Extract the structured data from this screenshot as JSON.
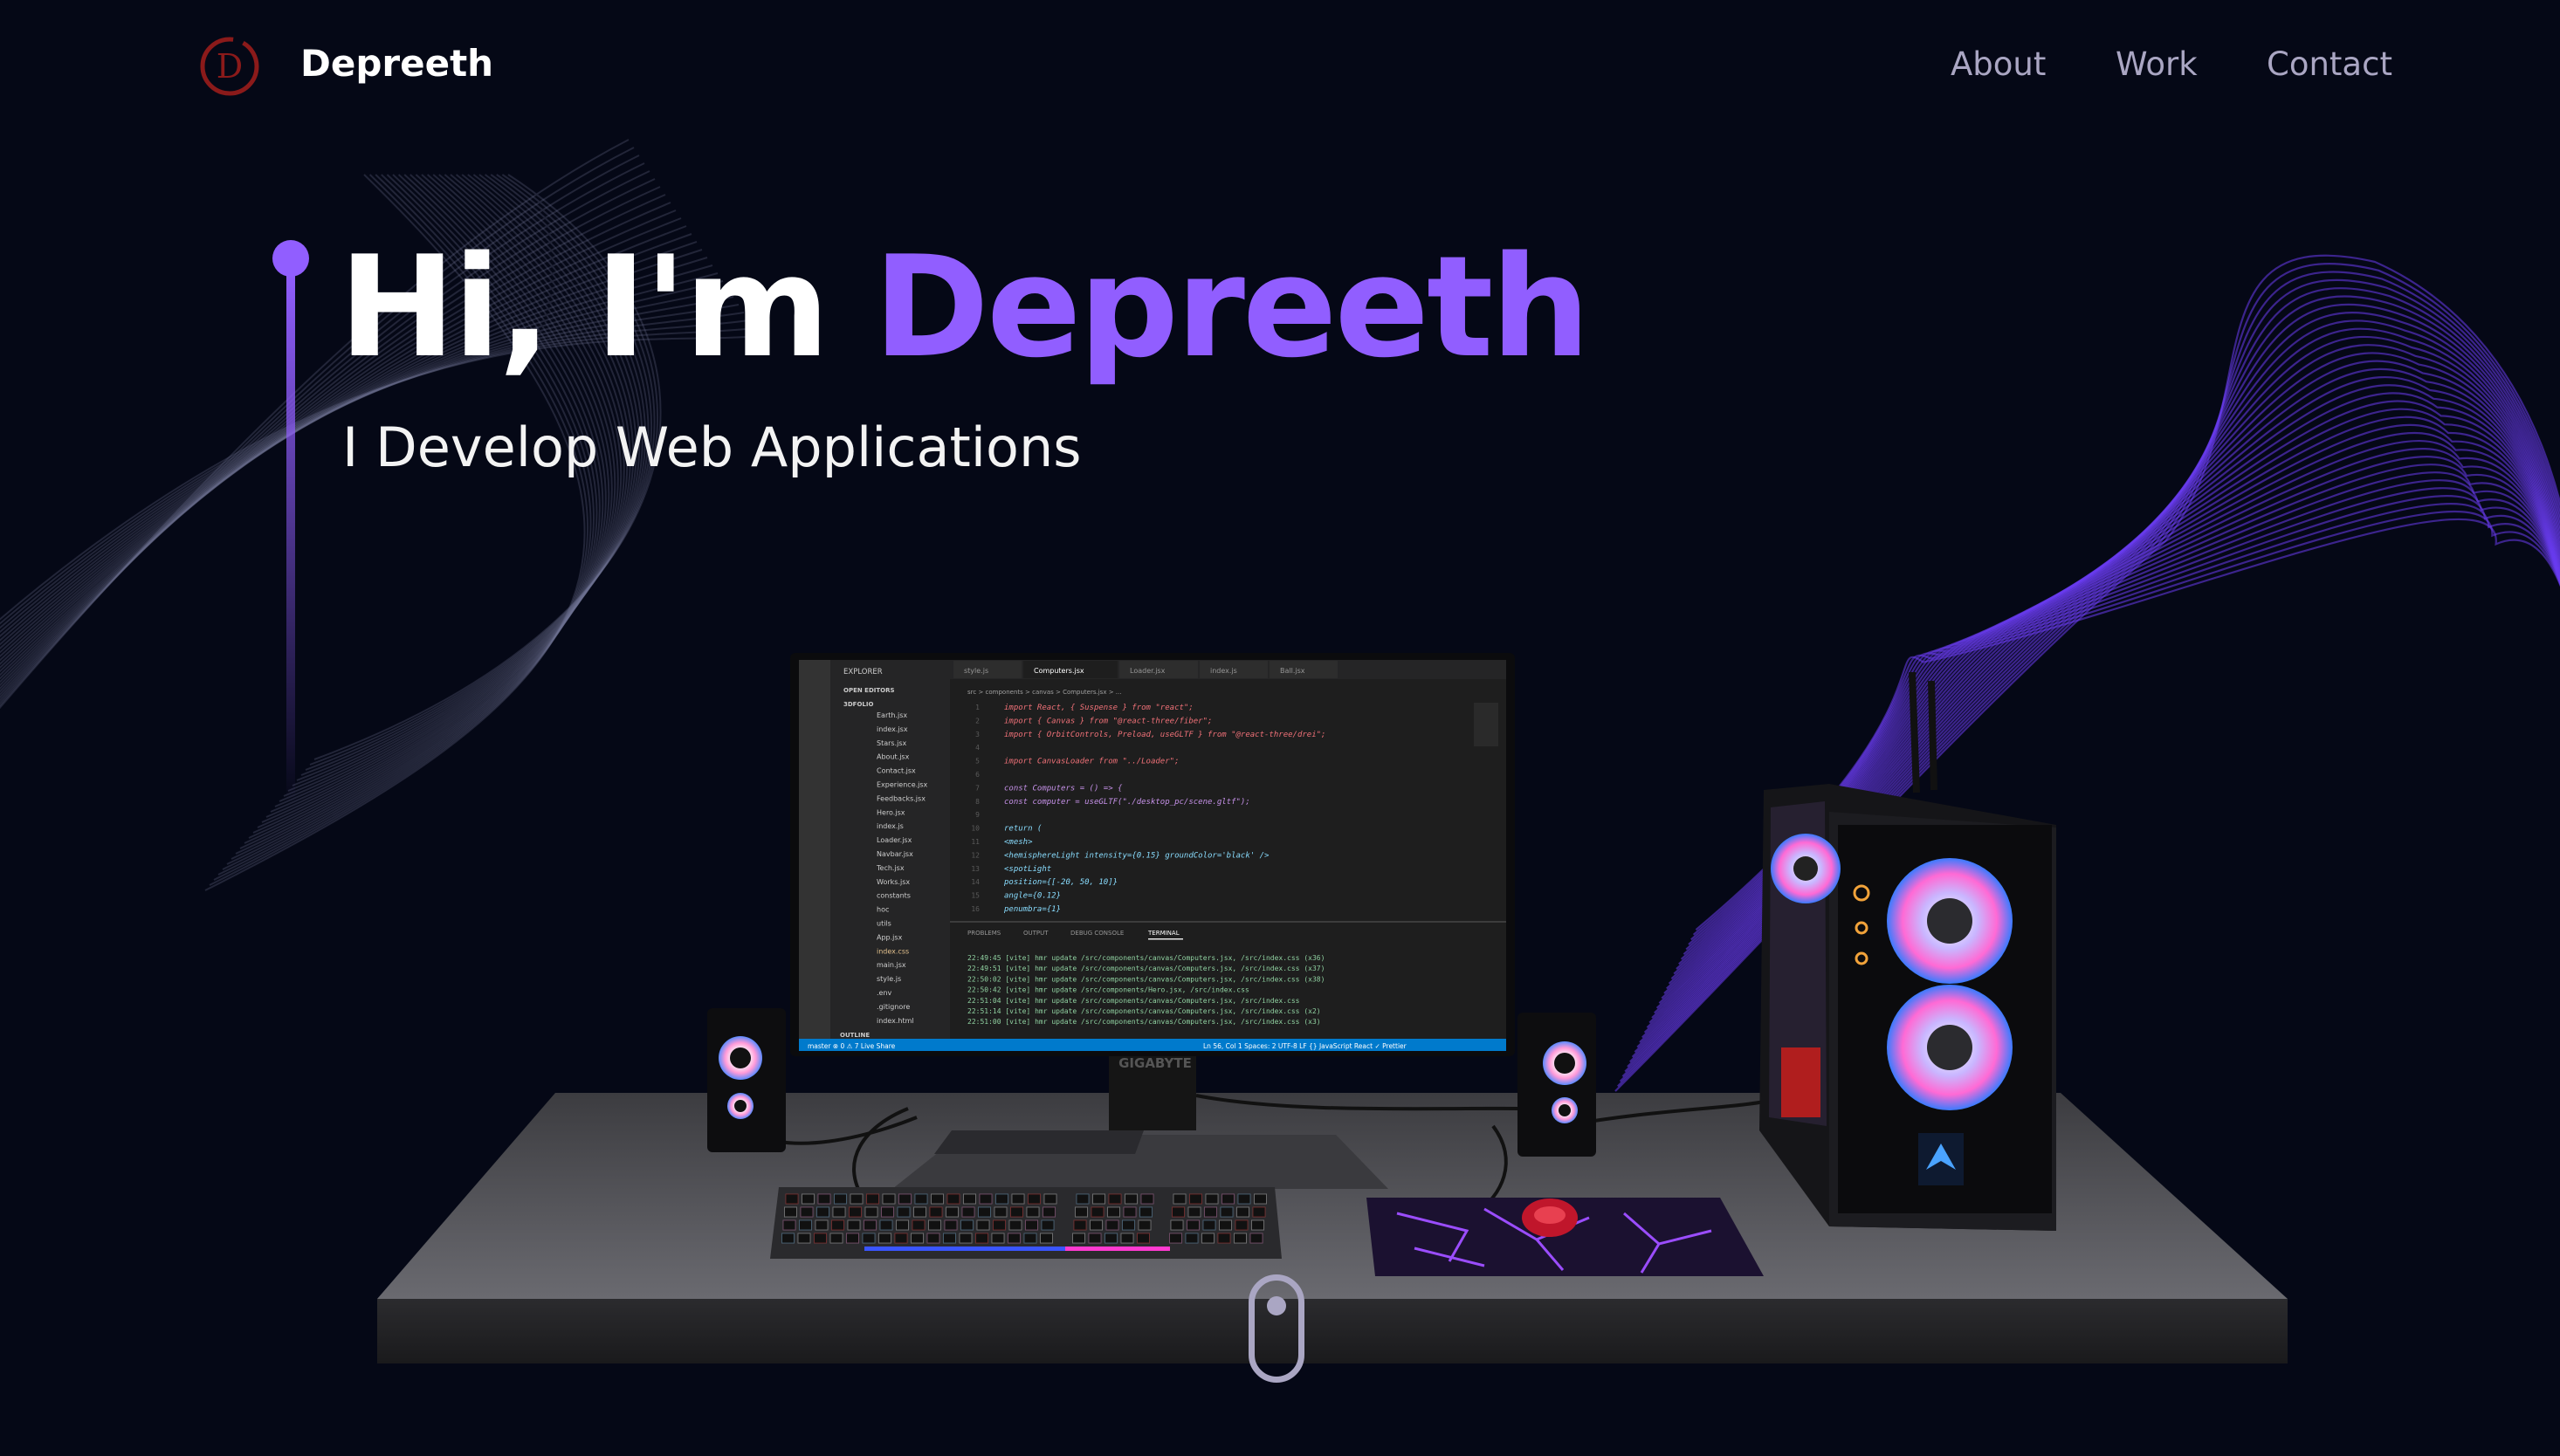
{
  "brand": {
    "name": "Depreeth",
    "logo_letter": "D",
    "logo_color": "#8b1a1a"
  },
  "nav": {
    "links": [
      "About",
      "Work",
      "Contact"
    ]
  },
  "hero": {
    "greeting": "Hi, I'm ",
    "name": "Depreeth",
    "subtitle": "I Develop Web Applications",
    "accent": "#915eff"
  },
  "monitor": {
    "brand": "GIGABYTE",
    "sidebar_title": "EXPLORER",
    "sidebar_sections": [
      "OPEN EDITORS",
      "3DFOLIO"
    ],
    "files": [
      "Earth.jsx",
      "index.jsx",
      "Stars.jsx",
      "About.jsx",
      "Contact.jsx",
      "Experience.jsx",
      "Feedbacks.jsx",
      "Hero.jsx",
      "index.js",
      "Loader.jsx",
      "Navbar.jsx",
      "Tech.jsx",
      "Works.jsx",
      "constants",
      "hoc",
      "utils",
      "App.jsx",
      "index.css",
      "main.jsx",
      "style.js",
      ".env",
      ".gitignore",
      "index.html"
    ],
    "outline_label": "OUTLINE",
    "tabs": [
      "style.js",
      "Computers.jsx",
      "Loader.jsx",
      "index.js",
      "Ball.jsx"
    ],
    "breadcrumb": "src > components > canvas > Computers.jsx > ...",
    "code_lines": [
      "import React, { Suspense } from \"react\";",
      "import { Canvas } from \"@react-three/fiber\";",
      "import { OrbitControls, Preload, useGLTF } from \"@react-three/drei\";",
      "",
      "import CanvasLoader from \"../Loader\";",
      "",
      "const Computers = () => {",
      "  const computer = useGLTF(\"./desktop_pc/scene.gltf\");",
      "",
      "  return (",
      "    <mesh>",
      "      <hemisphereLight intensity={0.15} groundColor='black' />",
      "      <spotLight",
      "        position={[-20, 50, 10]}",
      "        angle={0.12}",
      "        penumbra={1}"
    ],
    "panel_tabs": [
      "PROBLEMS",
      "OUTPUT",
      "DEBUG CONSOLE",
      "TERMINAL"
    ],
    "terminal_lines": [
      "22:49:45 [vite] hmr update /src/components/canvas/Computers.jsx, /src/index.css (x36)",
      "22:49:51 [vite] hmr update /src/components/canvas/Computers.jsx, /src/index.css (x37)",
      "22:50:02 [vite] hmr update /src/components/canvas/Computers.jsx, /src/index.css (x38)",
      "22:50:42 [vite] hmr update /src/components/Hero.jsx, /src/index.css",
      "22:51:04 [vite] hmr update /src/components/canvas/Computers.jsx, /src/index.css",
      "22:51:14 [vite] hmr update /src/components/canvas/Computers.jsx, /src/index.css (x2)",
      "22:51:00 [vite] hmr update /src/components/canvas/Computers.jsx, /src/index.css (x3)"
    ],
    "status_left": "master  ⊗ 0 ⚠ 7   Live Share",
    "status_right": "Ln 56, Col 1   Spaces: 2   UTF-8   LF   {} JavaScript React   ✓ Prettier"
  }
}
